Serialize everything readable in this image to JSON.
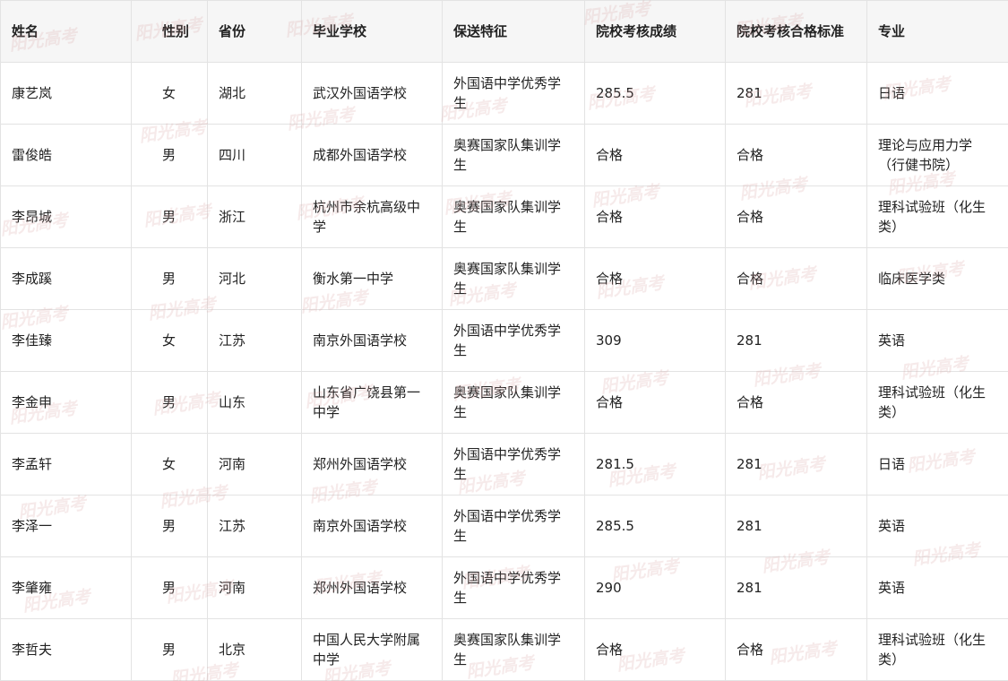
{
  "table": {
    "headers": [
      "姓名",
      "性别",
      "省份",
      "毕业学校",
      "保送特征",
      "院校考核成绩",
      "院校考核合格标准",
      "专业"
    ],
    "rows": [
      [
        "康艺岚",
        "女",
        "湖北",
        "武汉外国语学校",
        "外国语中学优秀学生",
        "285.5",
        "281",
        "日语"
      ],
      [
        "雷俊皓",
        "男",
        "四川",
        "成都外国语学校",
        "奥赛国家队集训学生",
        "合格",
        "合格",
        "理论与应用力学（行健书院）"
      ],
      [
        "李昂城",
        "男",
        "浙江",
        "杭州市余杭高级中学",
        "奥赛国家队集训学生",
        "合格",
        "合格",
        "理科试验班（化生类）"
      ],
      [
        "李成蹊",
        "男",
        "河北",
        "衡水第一中学",
        "奥赛国家队集训学生",
        "合格",
        "合格",
        "临床医学类"
      ],
      [
        "李佳臻",
        "女",
        "江苏",
        "南京外国语学校",
        "外国语中学优秀学生",
        "309",
        "281",
        "英语"
      ],
      [
        "李金申",
        "男",
        "山东",
        "山东省广饶县第一中学",
        "奥赛国家队集训学生",
        "合格",
        "合格",
        "理科试验班（化生类）"
      ],
      [
        "李孟轩",
        "女",
        "河南",
        "郑州外国语学校",
        "外国语中学优秀学生",
        "281.5",
        "281",
        "日语"
      ],
      [
        "李泽一",
        "男",
        "江苏",
        "南京外国语学校",
        "外国语中学优秀学生",
        "285.5",
        "281",
        "英语"
      ],
      [
        "李肇雍",
        "男",
        "河南",
        "郑州外国语学校",
        "外国语中学优秀学生",
        "290",
        "281",
        "英语"
      ],
      [
        "李哲夫",
        "男",
        "北京",
        "中国人民大学附属中学",
        "奥赛国家队集训学生",
        "合格",
        "合格",
        "理科试验班（化生类）"
      ]
    ]
  },
  "watermark": {
    "text": "阳光高考",
    "color": "#d6a0a0"
  }
}
